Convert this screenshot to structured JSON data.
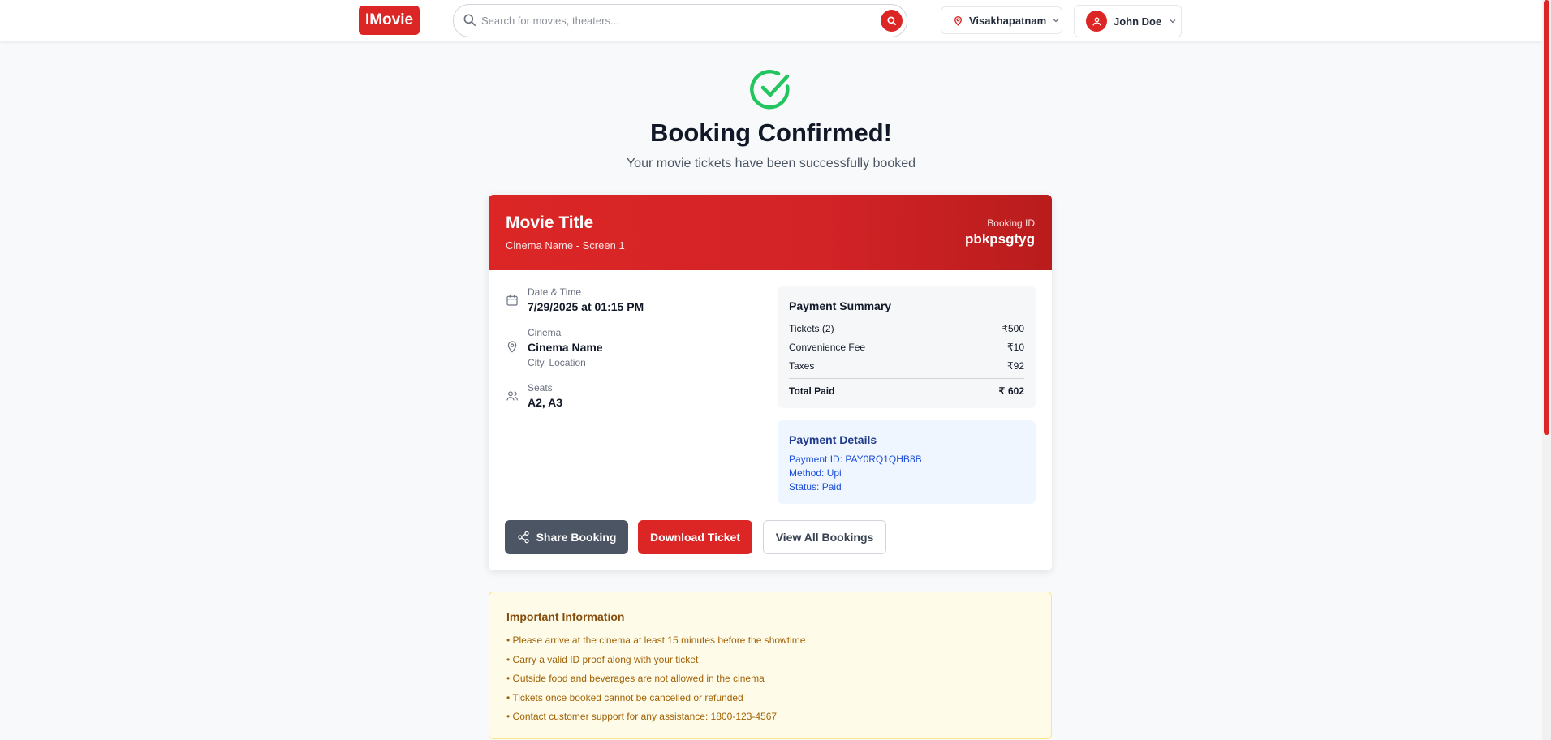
{
  "header": {
    "logo": "IMovie",
    "search_placeholder": "Search for movies, theaters...",
    "location": "Visakhapatnam",
    "user_name": "John Doe"
  },
  "confirmation": {
    "title": "Booking Confirmed!",
    "subtitle": "Your movie tickets have been successfully booked"
  },
  "ticket": {
    "movie_title": "Movie Title",
    "cinema_screen": "Cinema Name - Screen 1",
    "booking_id_label": "Booking ID",
    "booking_id": "pbkpsgtyg",
    "datetime_label": "Date & Time",
    "datetime_value": "7/29/2025 at 01:15 PM",
    "cinema_label": "Cinema",
    "cinema_value": "Cinema Name",
    "cinema_sub": "City, Location",
    "seats_label": "Seats",
    "seats_value": "A2, A3"
  },
  "payment_summary": {
    "title": "Payment Summary",
    "rows": [
      {
        "label": "Tickets (2)",
        "amount": "₹500"
      },
      {
        "label": "Convenience Fee",
        "amount": "₹10"
      },
      {
        "label": "Taxes",
        "amount": "₹92"
      }
    ],
    "total_label": "Total Paid",
    "total_amount": "₹  602"
  },
  "payment_details": {
    "title": "Payment Details",
    "payment_id": "Payment ID: PAY0RQ1QHB8B",
    "method": "Method: Upi",
    "status": "Status: Paid"
  },
  "actions": {
    "share": "Share Booking",
    "download": "Download Ticket",
    "view_all": "View All Bookings"
  },
  "important": {
    "title": "Important Information",
    "items": [
      "• Please arrive at the cinema at least 15 minutes before the showtime",
      "• Carry a valid ID proof along with your ticket",
      "• Outside food and beverages are not allowed in the cinema",
      "• Tickets once booked cannot be cancelled or refunded",
      "• Contact customer support for any assistance: 1800-123-4567"
    ]
  },
  "colors": {
    "brand_red": "#dc2626",
    "success_green": "#22c55e",
    "info_blue_bg": "#eff6ff",
    "warning_bg": "#fefce8"
  },
  "icons": [
    "search-icon",
    "map-pin-icon",
    "user-icon",
    "chevron-down-icon",
    "check-circle-icon",
    "calendar-icon",
    "users-icon",
    "share-icon"
  ]
}
